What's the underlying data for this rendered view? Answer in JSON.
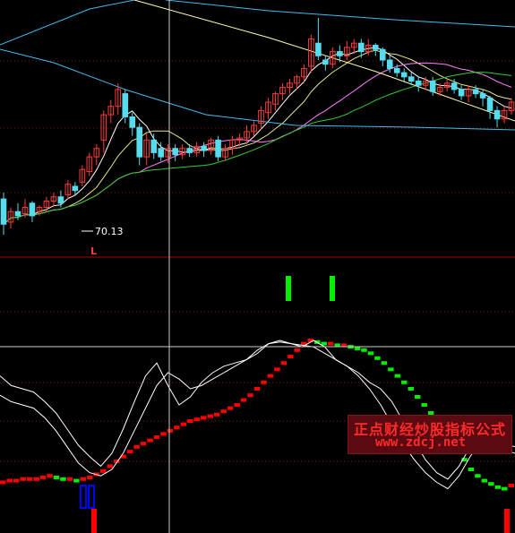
{
  "watermark": {
    "line1": "正点财经炒股指标公式",
    "line2": "www.zdcj.net"
  },
  "price_panel": {
    "low_label": "70.13",
    "low_marker": "L",
    "colors": {
      "up": "#ff3a3a",
      "down": "#55ddee",
      "ma5": "#ffffff",
      "ma10": "#e6e68a",
      "ma20": "#ff80ff",
      "ma30": "#33cc33",
      "ma60": "#44bbee",
      "ma120": "#ffffaa"
    }
  },
  "signal_colors": {
    "buy_bar": "#ff0000",
    "sell_bar": "#00ee00",
    "blue_box": "#0000ff"
  },
  "chart_data": {
    "type": "candlestick",
    "title": "",
    "xlabel": "",
    "ylabel": "",
    "annotations": [
      {
        "text": "70.13",
        "note": "period low"
      },
      {
        "text": "L"
      }
    ],
    "candles": [
      {
        "o": 0.42,
        "c": 0.3,
        "h": 0.25,
        "l": 0.45
      },
      {
        "o": 0.31,
        "c": 0.36,
        "h": 0.28,
        "l": 0.38
      },
      {
        "o": 0.36,
        "c": 0.34,
        "h": 0.32,
        "l": 0.4
      },
      {
        "o": 0.35,
        "c": 0.38,
        "h": 0.33,
        "l": 0.42
      },
      {
        "o": 0.4,
        "c": 0.34,
        "h": 0.31,
        "l": 0.41
      },
      {
        "o": 0.36,
        "c": 0.38,
        "h": 0.34,
        "l": 0.39
      },
      {
        "o": 0.38,
        "c": 0.41,
        "h": 0.36,
        "l": 0.43
      },
      {
        "o": 0.41,
        "c": 0.43,
        "h": 0.38,
        "l": 0.45
      },
      {
        "o": 0.43,
        "c": 0.4,
        "h": 0.38,
        "l": 0.46
      },
      {
        "o": 0.44,
        "c": 0.49,
        "h": 0.42,
        "l": 0.51
      },
      {
        "o": 0.48,
        "c": 0.46,
        "h": 0.44,
        "l": 0.5
      },
      {
        "o": 0.5,
        "c": 0.56,
        "h": 0.48,
        "l": 0.58
      },
      {
        "o": 0.55,
        "c": 0.62,
        "h": 0.53,
        "l": 0.64
      },
      {
        "o": 0.62,
        "c": 0.66,
        "h": 0.58,
        "l": 0.68
      },
      {
        "o": 0.7,
        "c": 0.82,
        "h": 0.64,
        "l": 0.84
      },
      {
        "o": 0.82,
        "c": 0.86,
        "h": 0.78,
        "l": 0.89
      },
      {
        "o": 0.86,
        "c": 0.94,
        "h": 0.82,
        "l": 0.97
      },
      {
        "o": 0.92,
        "c": 0.81,
        "h": 0.78,
        "l": 0.94
      },
      {
        "o": 0.81,
        "c": 0.76,
        "h": 0.72,
        "l": 0.83
      },
      {
        "o": 0.76,
        "c": 0.62,
        "h": 0.58,
        "l": 0.78
      },
      {
        "o": 0.62,
        "c": 0.7,
        "h": 0.58,
        "l": 0.73
      },
      {
        "o": 0.7,
        "c": 0.64,
        "h": 0.61,
        "l": 0.73
      },
      {
        "o": 0.66,
        "c": 0.62,
        "h": 0.6,
        "l": 0.69
      },
      {
        "o": 0.62,
        "c": 0.66,
        "h": 0.59,
        "l": 0.68
      },
      {
        "o": 0.66,
        "c": 0.63,
        "h": 0.6,
        "l": 0.68
      },
      {
        "o": 0.63,
        "c": 0.66,
        "h": 0.61,
        "l": 0.68
      },
      {
        "o": 0.66,
        "c": 0.64,
        "h": 0.62,
        "l": 0.68
      },
      {
        "o": 0.64,
        "c": 0.67,
        "h": 0.62,
        "l": 0.69
      },
      {
        "o": 0.67,
        "c": 0.65,
        "h": 0.62,
        "l": 0.69
      },
      {
        "o": 0.65,
        "c": 0.7,
        "h": 0.63,
        "l": 0.71
      },
      {
        "o": 0.7,
        "c": 0.62,
        "h": 0.6,
        "l": 0.72
      },
      {
        "o": 0.62,
        "c": 0.66,
        "h": 0.6,
        "l": 0.68
      },
      {
        "o": 0.66,
        "c": 0.7,
        "h": 0.63,
        "l": 0.72
      },
      {
        "o": 0.7,
        "c": 0.71,
        "h": 0.67,
        "l": 0.73
      },
      {
        "o": 0.71,
        "c": 0.74,
        "h": 0.68,
        "l": 0.77
      },
      {
        "o": 0.74,
        "c": 0.77,
        "h": 0.72,
        "l": 0.79
      },
      {
        "o": 0.78,
        "c": 0.84,
        "h": 0.75,
        "l": 0.86
      },
      {
        "o": 0.83,
        "c": 0.88,
        "h": 0.8,
        "l": 0.9
      },
      {
        "o": 0.87,
        "c": 0.92,
        "h": 0.84,
        "l": 0.93
      },
      {
        "o": 0.92,
        "c": 0.95,
        "h": 0.89,
        "l": 0.97
      },
      {
        "o": 0.95,
        "c": 0.97,
        "h": 0.92,
        "l": 0.99
      },
      {
        "o": 0.97,
        "c": 1.0,
        "h": 0.94,
        "l": 1.01
      },
      {
        "o": 1.0,
        "c": 1.04,
        "h": 0.97,
        "l": 1.06
      },
      {
        "o": 1.05,
        "c": 1.18,
        "h": 1.02,
        "l": 1.2
      },
      {
        "o": 1.16,
        "c": 1.1,
        "h": 1.08,
        "l": 1.28
      },
      {
        "o": 1.08,
        "c": 1.06,
        "h": 1.03,
        "l": 1.1
      },
      {
        "o": 1.06,
        "c": 1.12,
        "h": 1.04,
        "l": 1.14
      },
      {
        "o": 1.12,
        "c": 1.1,
        "h": 1.07,
        "l": 1.15
      },
      {
        "o": 1.1,
        "c": 1.14,
        "h": 1.08,
        "l": 1.17
      },
      {
        "o": 1.14,
        "c": 1.16,
        "h": 1.11,
        "l": 1.18
      },
      {
        "o": 1.16,
        "c": 1.12,
        "h": 1.09,
        "l": 1.18
      },
      {
        "o": 1.12,
        "c": 1.15,
        "h": 1.1,
        "l": 1.18
      },
      {
        "o": 1.15,
        "c": 1.13,
        "h": 1.1,
        "l": 1.16
      },
      {
        "o": 1.13,
        "c": 1.08,
        "h": 1.05,
        "l": 1.14
      },
      {
        "o": 1.08,
        "c": 1.04,
        "h": 1.02,
        "l": 1.1
      },
      {
        "o": 1.04,
        "c": 1.02,
        "h": 1.0,
        "l": 1.06
      },
      {
        "o": 1.02,
        "c": 1.0,
        "h": 0.98,
        "l": 1.04
      },
      {
        "o": 1.0,
        "c": 0.98,
        "h": 0.96,
        "l": 1.02
      },
      {
        "o": 0.98,
        "c": 0.96,
        "h": 0.93,
        "l": 1.0
      },
      {
        "o": 0.96,
        "c": 0.98,
        "h": 0.94,
        "l": 1.0
      },
      {
        "o": 0.98,
        "c": 0.93,
        "h": 0.91,
        "l": 1.0
      },
      {
        "o": 0.93,
        "c": 0.95,
        "h": 0.91,
        "l": 0.97
      },
      {
        "o": 0.95,
        "c": 0.97,
        "h": 0.93,
        "l": 0.99
      },
      {
        "o": 0.97,
        "c": 0.94,
        "h": 0.92,
        "l": 0.99
      },
      {
        "o": 0.94,
        "c": 0.91,
        "h": 0.89,
        "l": 0.96
      },
      {
        "o": 0.91,
        "c": 0.94,
        "h": 0.88,
        "l": 0.96
      },
      {
        "o": 0.94,
        "c": 0.92,
        "h": 0.9,
        "l": 0.96
      },
      {
        "o": 0.92,
        "c": 0.9,
        "h": 0.86,
        "l": 0.94
      },
      {
        "o": 0.9,
        "c": 0.84,
        "h": 0.8,
        "l": 0.91
      },
      {
        "o": 0.84,
        "c": 0.8,
        "h": 0.76,
        "l": 0.86
      },
      {
        "o": 0.8,
        "c": 0.84,
        "h": 0.78,
        "l": 0.86
      },
      {
        "o": 0.84,
        "c": 0.88,
        "h": 0.82,
        "l": 0.9
      }
    ],
    "series": [
      {
        "type": "step-bars",
        "note": "red rising / green falling signal line",
        "values": [
          0.12,
          0.13,
          0.13,
          0.14,
          0.14,
          0.14,
          0.15,
          0.16,
          0.15,
          0.14,
          0.14,
          0.13,
          0.14,
          0.15,
          0.17,
          0.19,
          0.22,
          0.25,
          0.28,
          0.31,
          0.34,
          0.36,
          0.38,
          0.4,
          0.42,
          0.44,
          0.46,
          0.48,
          0.5,
          0.51,
          0.52,
          0.53,
          0.54,
          0.56,
          0.58,
          0.6,
          0.63,
          0.66,
          0.7,
          0.74,
          0.78,
          0.82,
          0.86,
          0.9,
          0.94,
          0.98,
          1.0,
          0.99,
          0.98,
          0.98,
          0.97,
          0.97,
          0.96,
          0.95,
          0.94,
          0.92,
          0.89,
          0.86,
          0.82,
          0.78,
          0.74,
          0.7,
          0.65,
          0.6,
          0.55,
          0.5,
          0.44,
          0.38,
          0.32,
          0.26,
          0.2,
          0.16,
          0.13,
          0.11,
          0.09,
          0.08,
          0.1
        ]
      },
      {
        "type": "line",
        "note": "fast white oscillator",
        "values": [
          0.78,
          0.72,
          0.7,
          0.68,
          0.62,
          0.55,
          0.45,
          0.35,
          0.28,
          0.22,
          0.3,
          0.45,
          0.62,
          0.78,
          0.86,
          0.72,
          0.6,
          0.65,
          0.74,
          0.8,
          0.84,
          0.86,
          0.88,
          0.92,
          0.98,
          1.0,
          0.98,
          0.96,
          1.0,
          0.96,
          0.88,
          0.84,
          0.8,
          0.74,
          0.7,
          0.62,
          0.5,
          0.38,
          0.26,
          0.18,
          0.14,
          0.22,
          0.34,
          0.42,
          0.38,
          0.32,
          0.3
        ]
      },
      {
        "type": "line",
        "note": "slow white oscillator",
        "values": [
          0.66,
          0.62,
          0.6,
          0.58,
          0.52,
          0.44,
          0.34,
          0.24,
          0.18,
          0.16,
          0.2,
          0.3,
          0.44,
          0.58,
          0.72,
          0.8,
          0.76,
          0.7,
          0.72,
          0.76,
          0.8,
          0.84,
          0.88,
          0.94,
          0.98,
          0.99,
          0.98,
          0.97,
          0.96,
          0.92,
          0.88,
          0.84,
          0.78,
          0.7,
          0.6,
          0.48,
          0.36,
          0.26,
          0.18,
          0.12,
          0.08,
          0.16,
          0.28,
          0.38,
          0.4,
          0.36,
          0.34
        ]
      }
    ]
  }
}
